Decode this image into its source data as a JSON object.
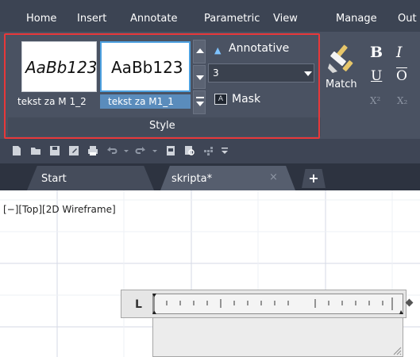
{
  "ribbon": {
    "tabs": [
      {
        "label": "Home"
      },
      {
        "label": "Insert"
      },
      {
        "label": "Annotate"
      },
      {
        "label": "Parametric"
      },
      {
        "label": "View"
      },
      {
        "label": "Manage"
      },
      {
        "label": "Out"
      }
    ]
  },
  "style_panel": {
    "title": "Style",
    "styles": [
      {
        "preview": "AaBb123",
        "name": "tekst za M 1_2",
        "selected": false
      },
      {
        "preview": "AaBb123",
        "name": "tekst za M1_1",
        "selected": true
      }
    ],
    "annotative_label": "Annotative",
    "text_height_value": "3",
    "mask_label": "Mask",
    "mask_icon_text": "A"
  },
  "formatting_panel": {
    "match_label": "Match",
    "bold": "B",
    "italic": "I",
    "underline": "U",
    "overline": "O",
    "superscript": "X²",
    "subscript": "X₂"
  },
  "file_tabs": {
    "start_label": "Start",
    "active_label": "skripta*",
    "close_glyph": "×",
    "add_glyph": "+"
  },
  "viewport": {
    "label": "[−][Top][2D Wireframe]"
  },
  "ruler": {
    "indent_glyph": "L"
  },
  "colors": {
    "highlight_border": "#e8383a",
    "selected_style": "#4da1e0",
    "ribbon_bg": "#4a5262"
  }
}
